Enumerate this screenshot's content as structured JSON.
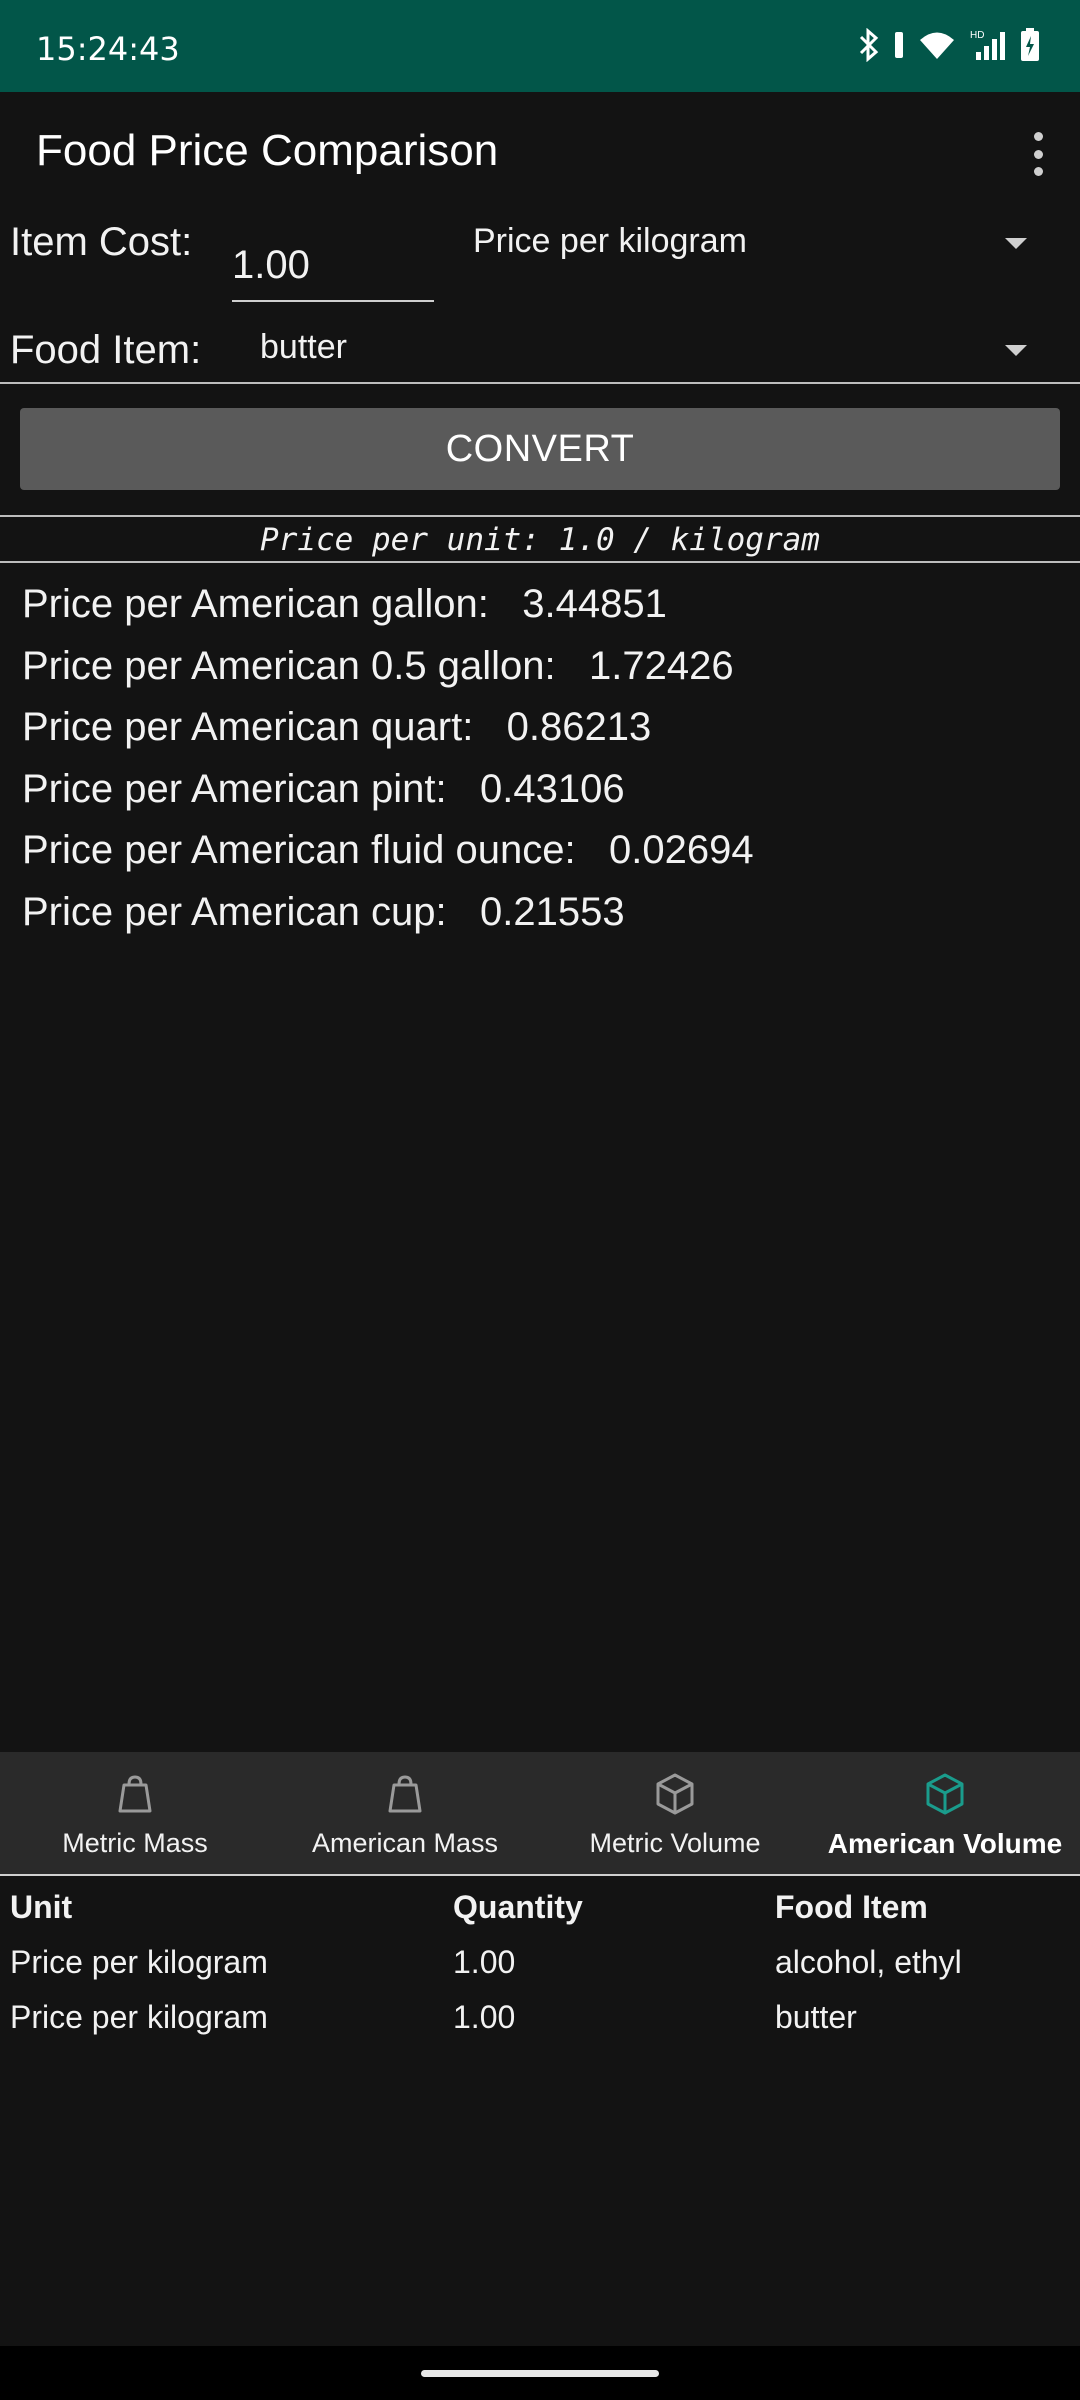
{
  "status_bar": {
    "time": "15:24:43",
    "icons": [
      "bluetooth-icon",
      "wifi-icon",
      "signal-icon",
      "battery-icon"
    ],
    "hd_label": "HD"
  },
  "app_bar": {
    "title": "Food Price Comparison",
    "menu_icon": "more-vert-icon"
  },
  "form": {
    "item_cost_label": "Item Cost:",
    "item_cost_value": "1.00",
    "unit_selected": "Price per kilogram",
    "food_item_label": "Food Item:",
    "food_item_selected": "butter"
  },
  "convert_button": "CONVERT",
  "unit_summary": "Price per unit: 1.0 / kilogram",
  "results": [
    {
      "label": "Price per American gallon:",
      "value": "3.44851"
    },
    {
      "label": "Price per American 0.5 gallon:",
      "value": "1.72426"
    },
    {
      "label": "Price per American quart:",
      "value": "0.86213"
    },
    {
      "label": "Price per American pint:",
      "value": "0.43106"
    },
    {
      "label": "Price per American fluid ounce:",
      "value": "0.02694"
    },
    {
      "label": "Price per American cup:",
      "value": "0.21553"
    }
  ],
  "bottom_nav": [
    {
      "label": "Metric Mass",
      "icon": "weight-icon",
      "active": false
    },
    {
      "label": "American Mass",
      "icon": "weight-icon",
      "active": false
    },
    {
      "label": "Metric Volume",
      "icon": "cube-icon",
      "active": false
    },
    {
      "label": "American Volume",
      "icon": "cube-icon",
      "active": true
    }
  ],
  "colors": {
    "status_bar": "#025649",
    "background": "#131313",
    "active_tab_icon": "#1a9c8c"
  },
  "history_table": {
    "headers": [
      "Unit",
      "Quantity",
      "Food Item"
    ],
    "rows": [
      [
        "Price per kilogram",
        "1.00",
        "alcohol, ethyl"
      ],
      [
        "Price per kilogram",
        "1.00",
        "butter"
      ]
    ]
  }
}
